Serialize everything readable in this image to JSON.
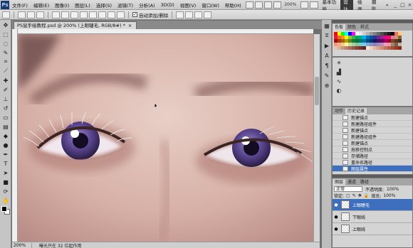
{
  "menubar": {
    "logo": "Ps",
    "items": [
      "文件(F)",
      "编辑(E)",
      "图像(I)",
      "图层(L)",
      "选择(S)",
      "滤镜(T)",
      "分析(A)",
      "3D(D)",
      "视图(V)",
      "窗口(W)",
      "帮助(H)"
    ],
    "zoom": "200%",
    "workspaces": [
      "基本功能",
      "设计",
      "绘画",
      "摄影"
    ],
    "active_workspace": "设计",
    "more": "»",
    "window_controls": [
      "_",
      "□",
      "×"
    ]
  },
  "options": {
    "auto_add_delete_label": "自动添加/删除"
  },
  "document": {
    "tab_title": "PS鼠手绘教程.psd @ 200% (上眼睫毛, RGB/8#) *",
    "tab_close": "×",
    "status_zoom": "200%",
    "status_info": "曝光只在 32 位起作用"
  },
  "swatches_panel": {
    "tabs": [
      "色板",
      "颜色",
      "样式"
    ],
    "colors": [
      "#ff0000",
      "#ffff00",
      "#00ff00",
      "#00ffff",
      "#0000ff",
      "#ff00ff",
      "#ffffff",
      "#e6e6e6",
      "#cccccc",
      "#b3b3b3",
      "#999999",
      "#808080",
      "#666666",
      "#4d4d4d",
      "#333333",
      "#1a1a1a",
      "#000000",
      "#ff6666",
      "#ffcc66",
      "#ed1c24",
      "#f26522",
      "#f7941d",
      "#fff200",
      "#8dc63f",
      "#39b54a",
      "#00a651",
      "#00a99d",
      "#00aeef",
      "#0072bc",
      "#0054a6",
      "#2e3192",
      "#662d91",
      "#92278f",
      "#ec008c",
      "#ed145b",
      "#f06eaa",
      "#c69c6d",
      "#8c6239",
      "#9e0b0f",
      "#a0410d",
      "#a36209",
      "#aba000",
      "#598527",
      "#197b30",
      "#007236",
      "#00746b",
      "#0076a3",
      "#004a80",
      "#003471",
      "#1b1464",
      "#440e62",
      "#630460",
      "#9e005d",
      "#9e0039",
      "#754c24",
      "#603913",
      "#362f2d",
      "#f7977a",
      "#f9ad81",
      "#fdc68a",
      "#fff79a",
      "#c4df9b",
      "#a3d39c",
      "#82ca9d",
      "#7bcdc8",
      "#6ecff6",
      "#7ea7d8",
      "#8493ca",
      "#8882be",
      "#a187be",
      "#bc8cbf",
      "#f49ac2",
      "#f6989d",
      "#998675",
      "#736357",
      "#c7b299",
      "#e0c8b0",
      "#d4b39a",
      "#c79a86",
      "#b98170",
      "#aa6b5b",
      "#9a5648",
      "#8a4238",
      "#7a2f29",
      "#6a1d1b",
      "#ffe4d6",
      "#f2cdb9",
      "#e6b7a0",
      "#d9a188",
      "#cc8b72",
      "#bf765d",
      "#b2614a",
      "#a54d38",
      "#983a28",
      "#8b2818"
    ]
  },
  "history_panel": {
    "tabs": [
      "动作",
      "历史记录"
    ],
    "rows": [
      "新建锚点",
      "新建路径组件",
      "新建锚点",
      "新建路径组件",
      "新建锚点",
      "拖移控制点",
      "存储路径",
      "重命名路径",
      "图层属性"
    ],
    "selected_index": 8
  },
  "layers_panel": {
    "tabs": [
      "图层",
      "通道",
      "路径"
    ],
    "blend_mode": "正常",
    "opacity_label": "不透明度:",
    "opacity_value": "100%",
    "lock_label": "锁定:",
    "fill_label": "填充:",
    "fill_value": "100%",
    "layers": [
      "上眼睫毛",
      "下眼线",
      "上眼线"
    ],
    "selected_index": 0
  },
  "colors": {
    "accent": "#3d6fbe",
    "skin": "#d9b5b0",
    "iris": "#4a3a78"
  },
  "icons": [
    "move-icon",
    "marquee-icon",
    "lasso-icon",
    "quick-select-icon",
    "crop-icon",
    "eyedropper-icon",
    "healing-icon",
    "brush-icon",
    "stamp-icon",
    "history-brush-icon",
    "eraser-icon",
    "gradient-icon",
    "blur-icon",
    "dodge-icon",
    "pen-icon",
    "type-icon",
    "path-select-icon",
    "shape-icon",
    "3d-rotate-icon",
    "hand-icon",
    "zoom-icon"
  ]
}
